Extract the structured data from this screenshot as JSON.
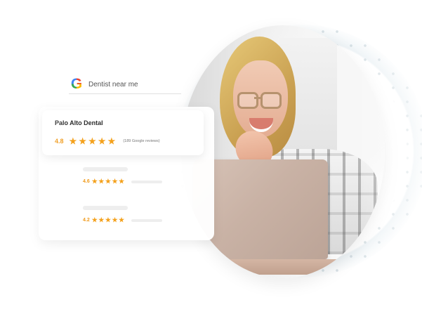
{
  "search": {
    "query": "Dentist near me",
    "icon": "google-g-icon"
  },
  "listing": {
    "business_name": "Palo Alto Dental",
    "rating": "4.8",
    "stars": "★★★★★",
    "review_count": "(189 Google reviews)"
  },
  "alternatives": [
    {
      "rating": "4.6",
      "stars": "★★★★★"
    },
    {
      "rating": "4.2",
      "stars": "★★★★★"
    }
  ],
  "colors": {
    "star": "#f4a11c",
    "card": "#ffffff",
    "text": "#2d2d2d"
  }
}
